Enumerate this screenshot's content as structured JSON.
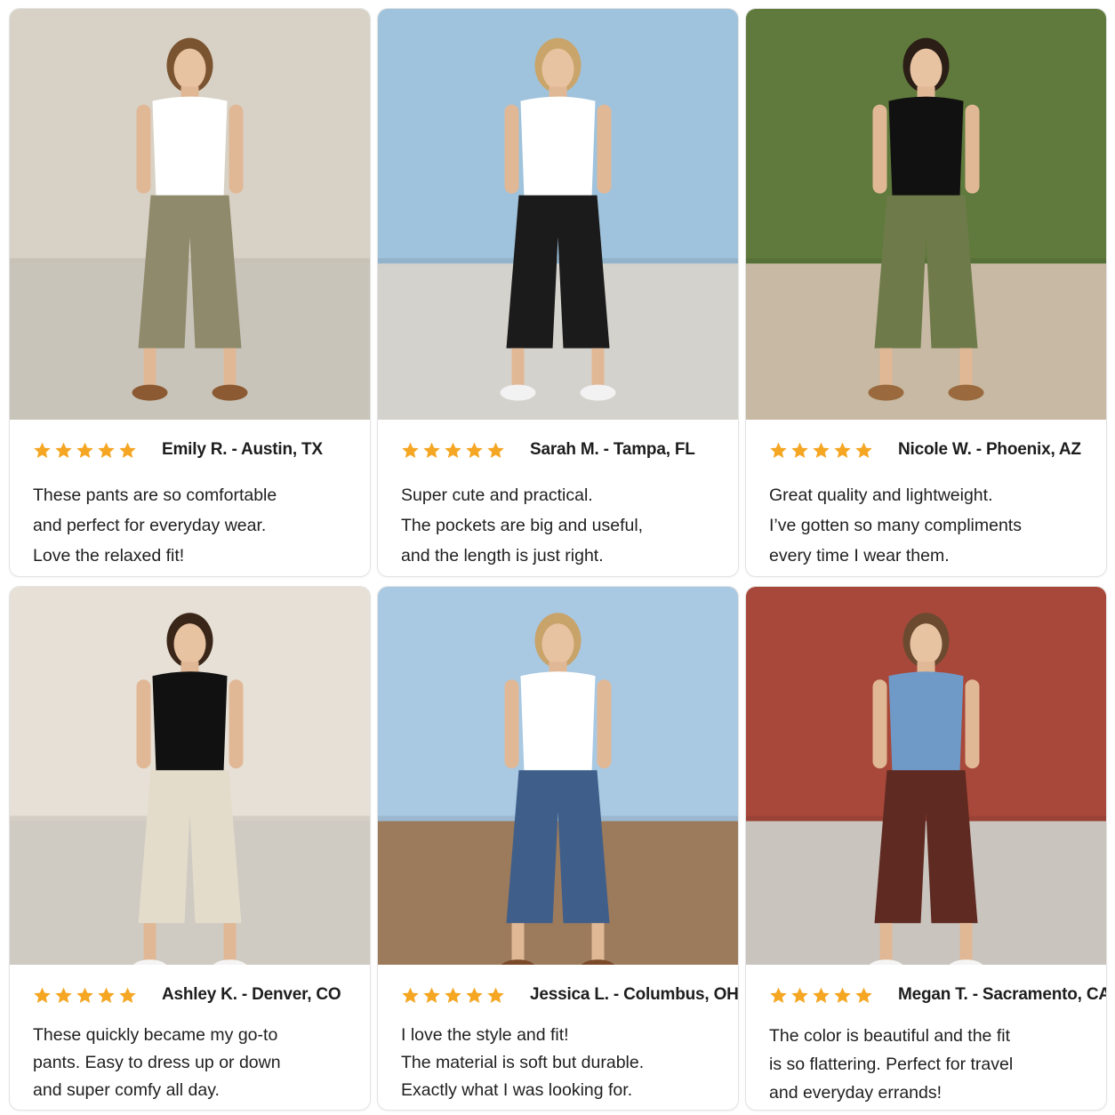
{
  "colors": {
    "star": "#F5A623",
    "text": "#1f1f1f"
  },
  "reviews": [
    {
      "name": "Emily R. - Austin, TX",
      "stars": 5,
      "lines": [
        "These pants are so comfortable",
        "and perfect for everyday wear.",
        "Love the relaxed fit!"
      ],
      "photo": {
        "top": "#ffffff",
        "pants": "#8f8a6c",
        "shoe": "#8b5a32",
        "bg": "#d8d2c6",
        "ground": "#c9c4ba",
        "hair": "#7a5330"
      }
    },
    {
      "name": "Sarah M. - Tampa, FL",
      "stars": 5,
      "lines": [
        "Super cute and practical.",
        "The pockets are big and useful,",
        "and the length is just right."
      ],
      "photo": {
        "top": "#ffffff",
        "pants": "#1b1b1b",
        "shoe": "#f2f2f2",
        "bg": "#9fc3dc",
        "ground": "#d4d2cc",
        "hair": "#c9a56b"
      }
    },
    {
      "name": "Nicole W. - Phoenix, AZ",
      "stars": 5,
      "lines": [
        "Great quality and lightweight.",
        "I’ve gotten so many compliments",
        "every time I wear them."
      ],
      "photo": {
        "top": "#111111",
        "pants": "#6e7a4a",
        "shoe": "#9a6a3e",
        "bg": "#5f7a3c",
        "ground": "#c7b9a3",
        "hair": "#2b1e16"
      }
    },
    {
      "name": "Ashley K. - Denver, CO",
      "stars": 5,
      "lines": [
        "These quickly became my go-to",
        "pants. Easy to dress up or down",
        "and super comfy all day."
      ],
      "photo": {
        "top": "#111111",
        "pants": "#e3dccb",
        "shoe": "#f4f4f4",
        "bg": "#e6e0d6",
        "ground": "#cfcac2",
        "hair": "#3a2618"
      }
    },
    {
      "name": "Jessica L. - Columbus, OH",
      "stars": 5,
      "lines": [
        "I love the style and fit!",
        "The material is soft but durable.",
        "Exactly what I was looking for."
      ],
      "photo": {
        "top": "#ffffff",
        "pants": "#3f5f8a",
        "shoe": "#7a4a2a",
        "bg": "#a9c8e2",
        "ground": "#9c7a5c",
        "hair": "#c8a36a"
      }
    },
    {
      "name": "Megan T. - Sacramento, CA",
      "stars": 5,
      "lines": [
        "The color is beautiful and the fit",
        "is so flattering. Perfect for travel",
        "and everyday errands!"
      ],
      "photo": {
        "top": "#6f9ac8",
        "pants": "#5e2a22",
        "shoe": "#f4f4f4",
        "bg": "#a8483a",
        "ground": "#c9c4bd",
        "hair": "#6b4a30"
      }
    }
  ]
}
